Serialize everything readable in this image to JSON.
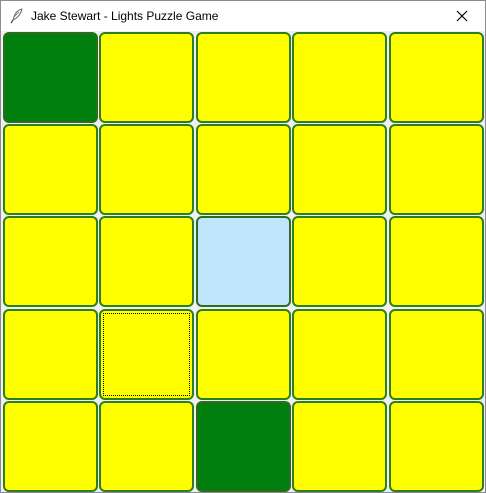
{
  "window": {
    "title": "Jake Stewart - Lights Puzzle Game",
    "icon": "feather-pen-icon",
    "close_icon": "close-icon"
  },
  "board": {
    "rows": 5,
    "cols": 5,
    "colors": {
      "off": "#ffff00",
      "on": "#007f0e",
      "hover": "#bfe6fb",
      "border": "#2e7d1f"
    },
    "cells": [
      [
        "on",
        "off",
        "off",
        "off",
        "off"
      ],
      [
        "off",
        "off",
        "off",
        "off",
        "off"
      ],
      [
        "off",
        "off",
        "hover",
        "off",
        "off"
      ],
      [
        "off",
        "off",
        "off",
        "off",
        "off"
      ],
      [
        "off",
        "off",
        "on",
        "off",
        "off"
      ]
    ],
    "focused_cell": {
      "row": 3,
      "col": 1
    }
  }
}
